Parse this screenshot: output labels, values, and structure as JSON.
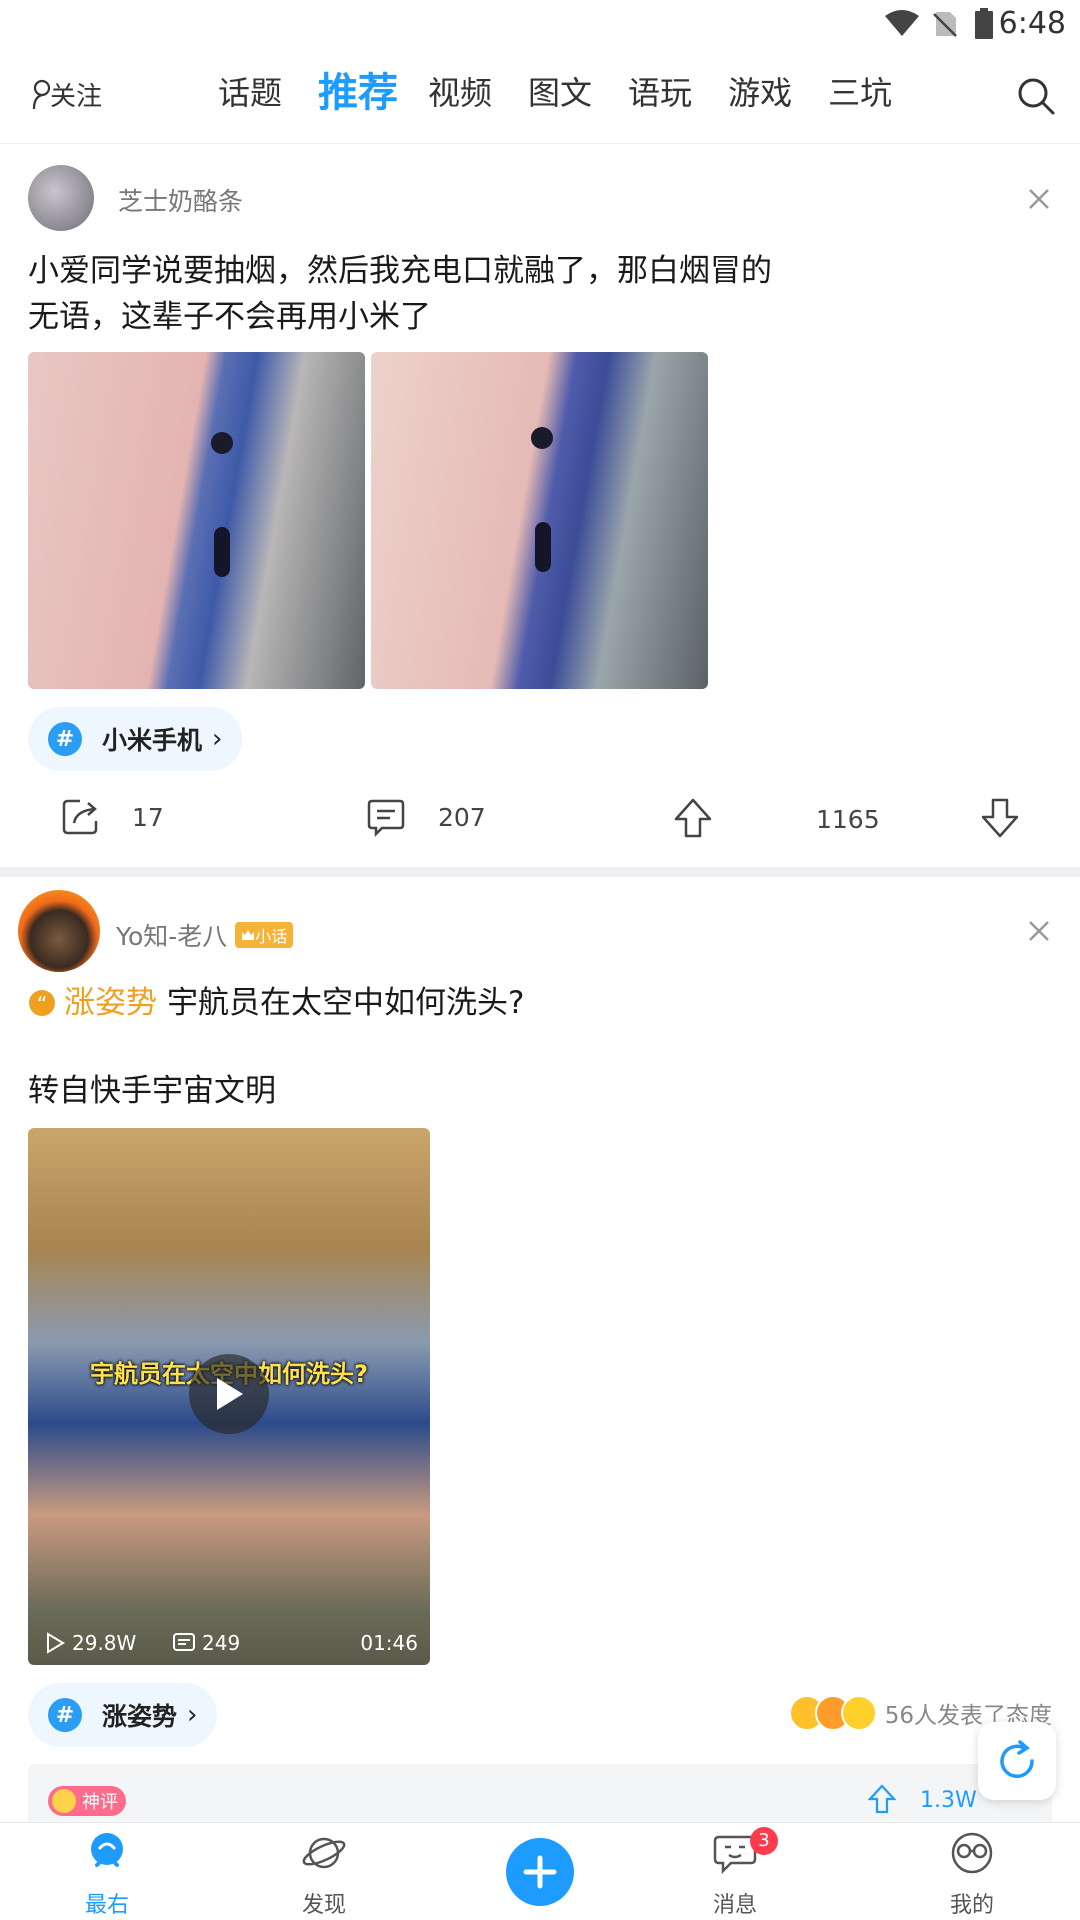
{
  "status_bar": {
    "time": "6:48"
  },
  "top_nav": {
    "follow_label": "关注",
    "tabs": [
      "话题",
      "推荐",
      "视频",
      "图文",
      "语玩",
      "游戏",
      "三坑"
    ],
    "active_tab": "推荐"
  },
  "post1": {
    "username": "芝士奶酪条",
    "text_line1": "小爱同学说要抽烟，然后我充电口就融了，那白烟冒的",
    "text_line2": "无语，这辈子不会再用小米了",
    "topic": "小米手机",
    "actions": {
      "share": "17",
      "comments": "207",
      "upvotes": "1165"
    }
  },
  "post2": {
    "username": "Yo知-老八",
    "badge": "小话",
    "tag_label": "涨姿势",
    "title": "宇航员在太空中如何洗头?",
    "subtext": "转自快手宇宙文明",
    "video": {
      "overlay_caption": "宇航员在太空中如何洗头?",
      "plays": "29.8W",
      "comments": "249",
      "duration": "01:46"
    },
    "topic": "涨姿势",
    "attitude_text": "56人发表了态度",
    "god_comment_label": "神评",
    "god_comment_votes": "1.3W"
  },
  "bottom_nav": {
    "home": "最右",
    "discover": "发现",
    "messages": "消息",
    "messages_badge": "3",
    "mine": "我的"
  },
  "colors": {
    "accent": "#1e9bff",
    "orange": "#f0a020"
  }
}
